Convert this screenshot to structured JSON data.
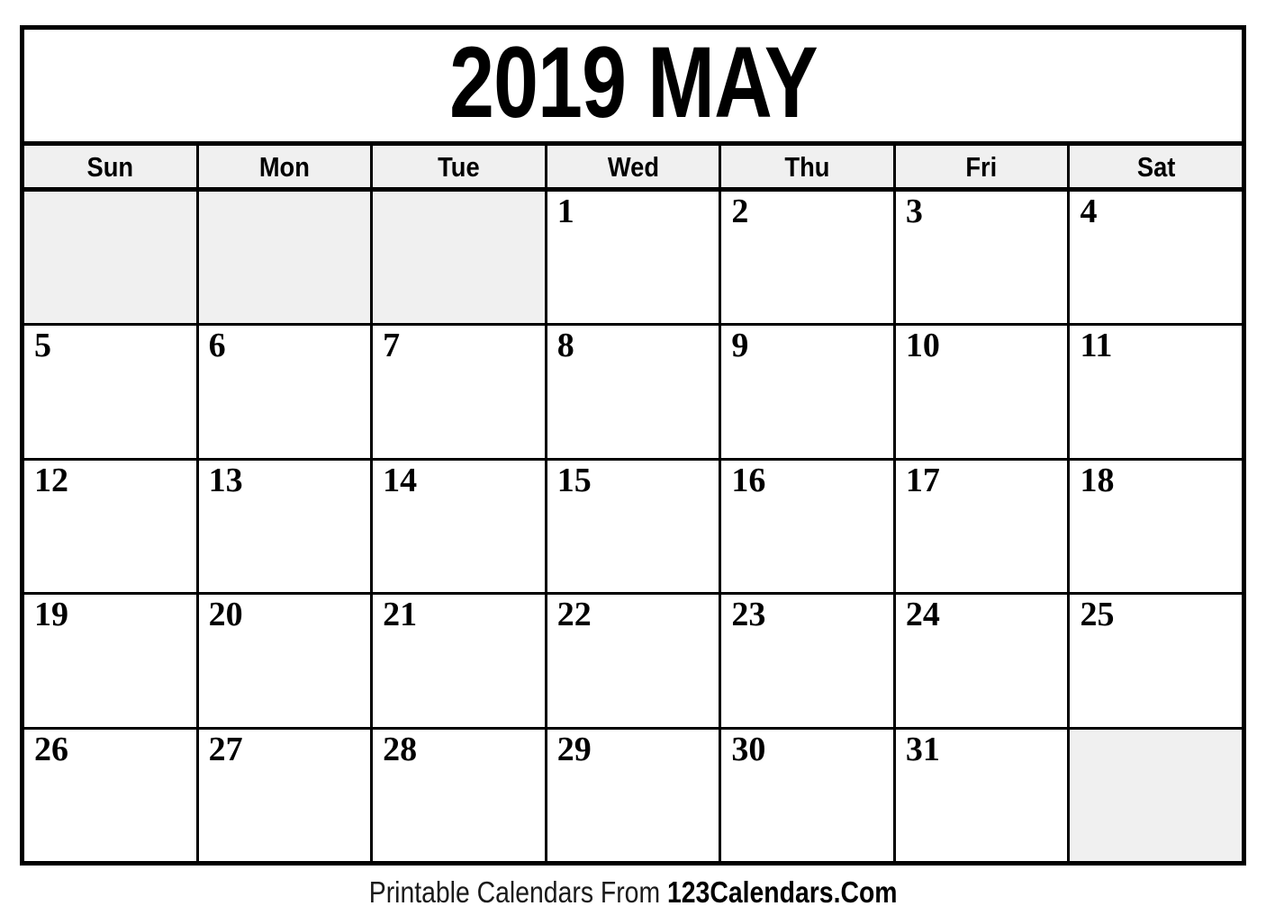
{
  "calendar": {
    "title": "2019 MAY",
    "year": "2019",
    "month": "MAY",
    "weekday_headers": [
      "Sun",
      "Mon",
      "Tue",
      "Wed",
      "Thu",
      "Fri",
      "Sat"
    ],
    "weeks": [
      [
        "",
        "",
        "",
        "1",
        "2",
        "3",
        "4"
      ],
      [
        "5",
        "6",
        "7",
        "8",
        "9",
        "10",
        "11"
      ],
      [
        "12",
        "13",
        "14",
        "15",
        "16",
        "17",
        "18"
      ],
      [
        "19",
        "20",
        "21",
        "22",
        "23",
        "24",
        "25"
      ],
      [
        "26",
        "27",
        "28",
        "29",
        "30",
        "31",
        ""
      ]
    ],
    "colors": {
      "border": "#000000",
      "blank_cell_fill": "#f0f0f0",
      "header_fill": "#f0f0f0",
      "page_background": "#ffffff",
      "text": "#000000"
    }
  },
  "footer": {
    "prefix": "Printable Calendars From ",
    "brand": "123Calendars.Com"
  }
}
